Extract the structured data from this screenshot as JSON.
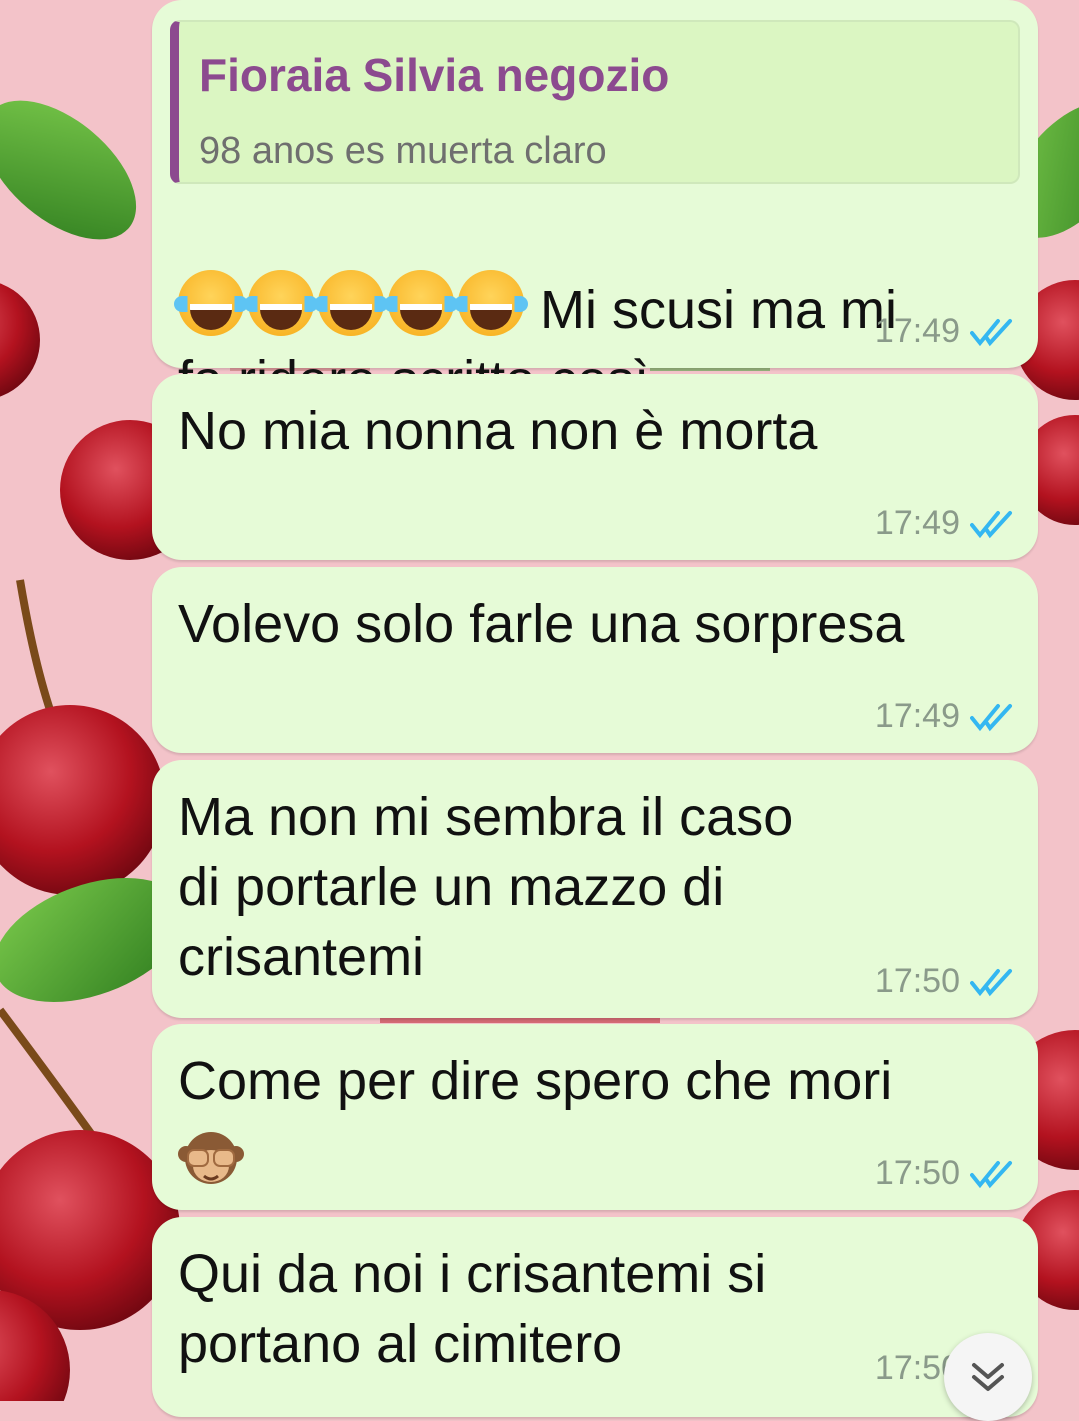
{
  "colors": {
    "bubble": "#e6fbd7",
    "quote_bg": "#dbf6c2",
    "quote_accent": "#8c4a8f",
    "ticks": "#34b7f1",
    "wallpaper": "#f3c3c9"
  },
  "quoted": {
    "author": "Fioraia Silvia negozio",
    "text": "98 anos es muerta claro"
  },
  "messages": [
    {
      "text": "Mi scusi ma mi\nfa ridere scritto così",
      "time": "17:49",
      "emoji": "face-with-tears-of-joy x5",
      "status": "read"
    },
    {
      "text": "No mia nonna non è morta",
      "time": "17:49",
      "status": "read"
    },
    {
      "text": "Volevo solo farle una sorpresa",
      "time": "17:49",
      "status": "read"
    },
    {
      "text": "Ma non mi sembra il caso\ndi portarle un mazzo di\ncrisantemi",
      "time": "17:50",
      "status": "read"
    },
    {
      "text": "Come per dire spero che mori",
      "time": "17:50",
      "emoji": "see-no-evil-monkey",
      "status": "read"
    },
    {
      "text": "Qui da noi i crisantemi si\nportano al cimitero",
      "time": "17:50",
      "status": "read"
    }
  ],
  "icons": {
    "read": "double-check-icon",
    "scroll": "double-chevron-down-icon"
  }
}
